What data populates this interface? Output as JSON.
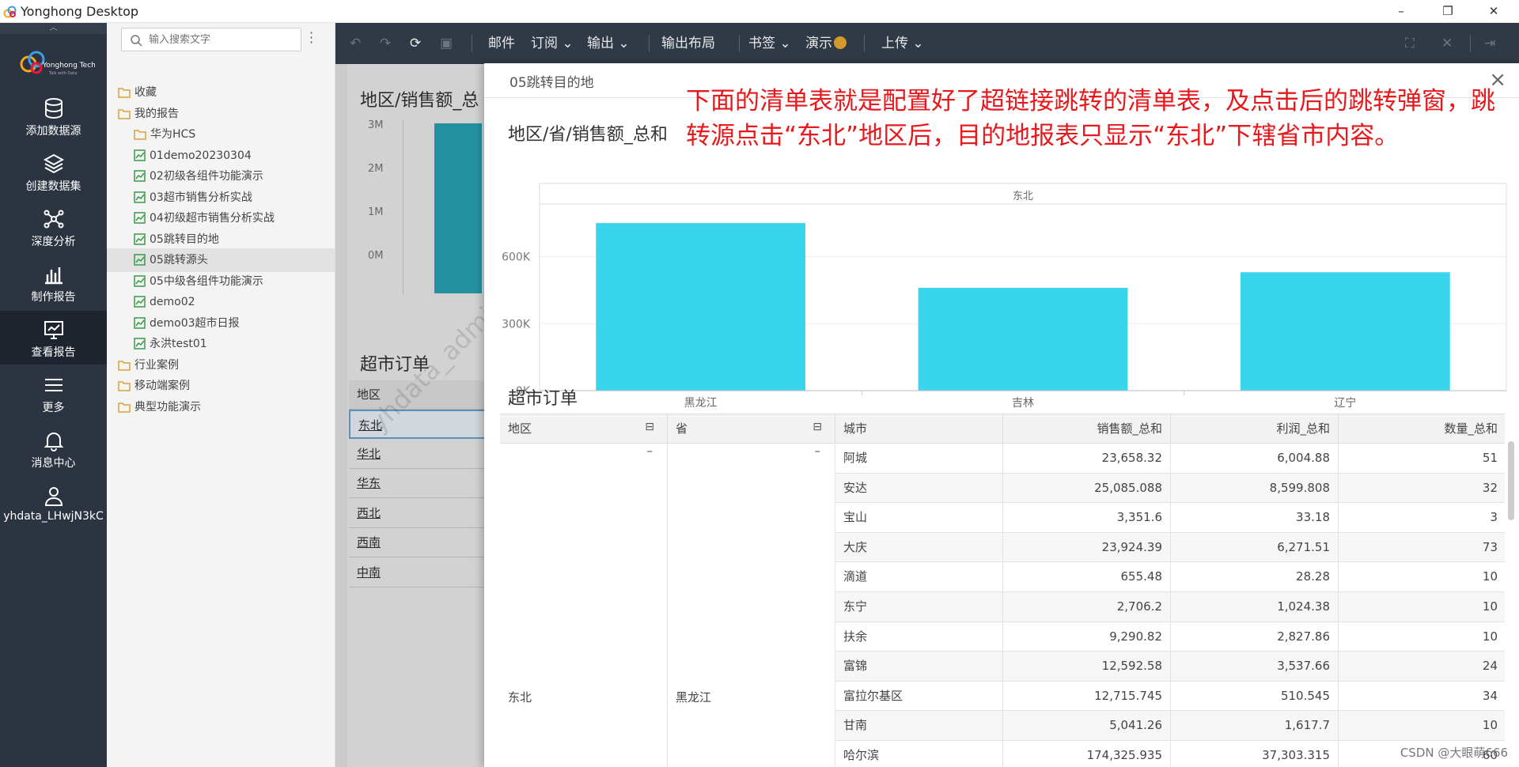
{
  "window": {
    "title": "Yonghong Desktop",
    "min": "–",
    "restore": "❐",
    "close": "✕"
  },
  "nav": {
    "items": [
      {
        "label": "添加数据源"
      },
      {
        "label": "创建数据集"
      },
      {
        "label": "深度分析"
      },
      {
        "label": "制作报告"
      },
      {
        "label": "查看报告"
      },
      {
        "label": "更多"
      },
      {
        "label": "消息中心"
      },
      {
        "label": "yhdata_LHwjN3kC"
      }
    ]
  },
  "tree": {
    "search_placeholder": "输入搜索文字",
    "items": [
      {
        "label": "收藏"
      },
      {
        "label": "我的报告"
      },
      {
        "label": "华为HCS"
      },
      {
        "label": "01demo20230304"
      },
      {
        "label": "02初级各组件功能演示"
      },
      {
        "label": "03超市销售分析实战"
      },
      {
        "label": "04初级超市销售分析实战"
      },
      {
        "label": "05跳转目的地"
      },
      {
        "label": "05跳转源头"
      },
      {
        "label": "05中级各组件功能演示"
      },
      {
        "label": "demo02"
      },
      {
        "label": "demo03超市日报"
      },
      {
        "label": "永洪test01"
      },
      {
        "label": "行业案例"
      },
      {
        "label": "移动端案例"
      },
      {
        "label": "典型功能演示"
      }
    ]
  },
  "toolbar": {
    "mail": "邮件",
    "subscribe": "订阅",
    "export": "输出",
    "layout": "输出布局",
    "bookmark": "书签",
    "present": "演示",
    "upload": "上传"
  },
  "background": {
    "chart_title": "地区/销售额_总",
    "y_ticks": [
      "3M",
      "2M",
      "1M",
      "0M"
    ],
    "table_title": "超市订单",
    "table_header": "地区",
    "regions": [
      "东北",
      "华北",
      "华东",
      "西北",
      "西南",
      "中南"
    ],
    "watermark": "yhdata_admin"
  },
  "modal": {
    "title": "05跳转目的地",
    "annotation": "下面的清单表就是配置好了超链接跳转的清单表，及点击后的跳转弹窗，跳转源点击“东北”地区后，目的地报表只显示“东北”下辖省市内容。",
    "chart_title": "地区/省/销售额_总和",
    "table_title": "超市订单",
    "table": {
      "headers": [
        "地区",
        "省",
        "城市",
        "销售额_总和",
        "利润_总和",
        "数量_总和"
      ],
      "region": "东北",
      "province": "黑龙江",
      "rows": [
        [
          "阿城",
          "23,658.32",
          "6,004.88",
          "51"
        ],
        [
          "安达",
          "25,085.088",
          "8,599.808",
          "32"
        ],
        [
          "宝山",
          "3,351.6",
          "33.18",
          "3"
        ],
        [
          "大庆",
          "23,924.39",
          "6,271.51",
          "73"
        ],
        [
          "滴道",
          "655.48",
          "28.28",
          "10"
        ],
        [
          "东宁",
          "2,706.2",
          "1,024.38",
          "10"
        ],
        [
          "扶余",
          "9,290.82",
          "2,827.86",
          "10"
        ],
        [
          "富锦",
          "12,592.58",
          "3,537.66",
          "24"
        ],
        [
          "富拉尔基区",
          "12,715.745",
          "510.545",
          "34"
        ],
        [
          "甘南",
          "5,041.26",
          "1,617.7",
          "10"
        ],
        [
          "哈尔滨",
          "174,325.935",
          "37,303.315",
          "60"
        ]
      ]
    }
  },
  "chart_data": {
    "type": "bar",
    "title": "地区/省/销售额_总和",
    "group_label": "东北",
    "categories": [
      "黑龙江",
      "吉林",
      "辽宁"
    ],
    "values": [
      750000,
      460000,
      530000
    ],
    "ylim": [
      0,
      800000
    ],
    "y_ticks": [
      "0K",
      "300K",
      "600K"
    ],
    "y_tick_values": [
      0,
      300000,
      600000
    ],
    "color": "#38d5ec"
  },
  "watermark": "CSDN @大眼萌666"
}
